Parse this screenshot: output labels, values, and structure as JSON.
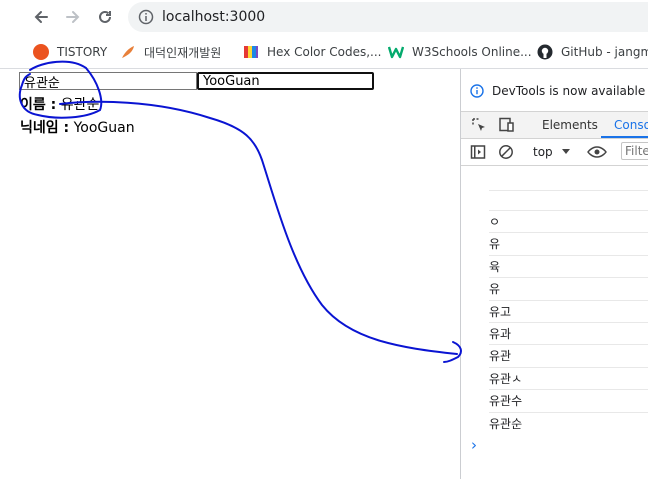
{
  "browser": {
    "url": "localhost:3000",
    "bookmarks": [
      {
        "label": "TISTORY",
        "icon": "tistory-icon",
        "color": "#eb531f"
      },
      {
        "label": "대덕인재개발원",
        "icon": "feather-icon",
        "color": "#e8803a"
      },
      {
        "label": "Hex Color Codes,...",
        "icon": "color-book-icon",
        "color": "#7b4cc2"
      },
      {
        "label": "W3Schools Online...",
        "icon": "w3schools-icon",
        "color": "#04aa6d"
      },
      {
        "label": "GitHub - jangmi",
        "icon": "github-icon",
        "color": "#24292f"
      }
    ]
  },
  "page": {
    "name_input_value": "유관순",
    "nickname_input_value": "YooGuan",
    "name_label": "이름 :",
    "name_value": "유관순",
    "nickname_label": "닉네임 :",
    "nickname_value": "YooGuan"
  },
  "devtools": {
    "notice": "DevTools is now available in K",
    "tabs": [
      "Elements",
      "Consol"
    ],
    "active_tab": "Consol",
    "context": "top",
    "filter_placeholder": "Filte",
    "logs": [
      "ㅇ",
      "유",
      "육",
      "유",
      "유고",
      "유과",
      "유관",
      "유관ㅅ",
      "유관수",
      "유관순"
    ],
    "prompt": "›"
  },
  "colors": {
    "annotation_ink": "#0a14d2",
    "devtools_accent": "#1a73e8"
  }
}
